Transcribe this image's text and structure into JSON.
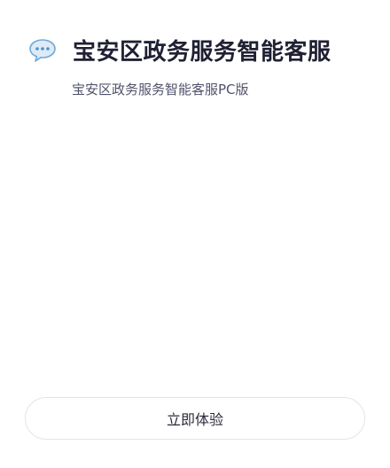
{
  "app": {
    "title": "宝安区政务服务智能客服",
    "subtitle": "宝安区政务服务智能客服PC版",
    "icon": "speech-bubble-icon"
  },
  "actions": {
    "start_label": "立即体验"
  },
  "colors": {
    "title": "#1f2033",
    "subtitle": "#50526a",
    "icon_fill": "#dcebf7",
    "icon_stroke": "#6ea8d8",
    "button_border": "#e3e4e8"
  }
}
